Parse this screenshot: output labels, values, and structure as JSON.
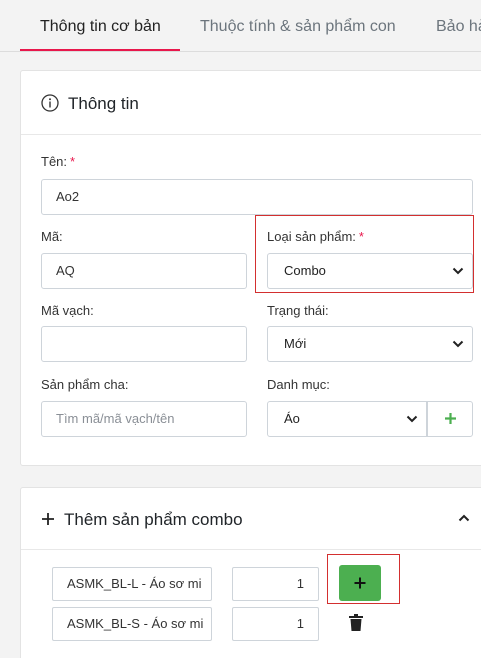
{
  "tabs": [
    {
      "label": "Thông tin cơ bản",
      "active": true
    },
    {
      "label": "Thuộc tính & sản phẩm con",
      "active": false
    },
    {
      "label": "Bảo hà",
      "active": false
    }
  ],
  "info_card": {
    "title": "Thông tin",
    "fields": {
      "name": {
        "label": "Tên:",
        "required_mark": "*",
        "value": "Ao2"
      },
      "code": {
        "label": "Mã:",
        "value": "AQ"
      },
      "product_type": {
        "label": "Loại sản phẩm:",
        "required_mark": "*",
        "value": "Combo"
      },
      "barcode": {
        "label": "Mã vạch:",
        "value": ""
      },
      "status": {
        "label": "Trạng thái:",
        "value": "Mới"
      },
      "parent_product": {
        "label": "Sản phẩm cha:",
        "placeholder": "Tìm mã/mã vạch/tên"
      },
      "category": {
        "label": "Danh mục:",
        "value": "Áo"
      }
    }
  },
  "combo_card": {
    "title": "Thêm sản phẩm combo",
    "items": [
      {
        "product": "ASMK_BL-L - Áo sơ mi",
        "quantity": "1"
      },
      {
        "product": "ASMK_BL-S - Áo sơ mi",
        "quantity": "1"
      }
    ]
  },
  "colors": {
    "accent": "#e8174c",
    "success": "#4caf50",
    "highlight": "#d32f2f"
  }
}
